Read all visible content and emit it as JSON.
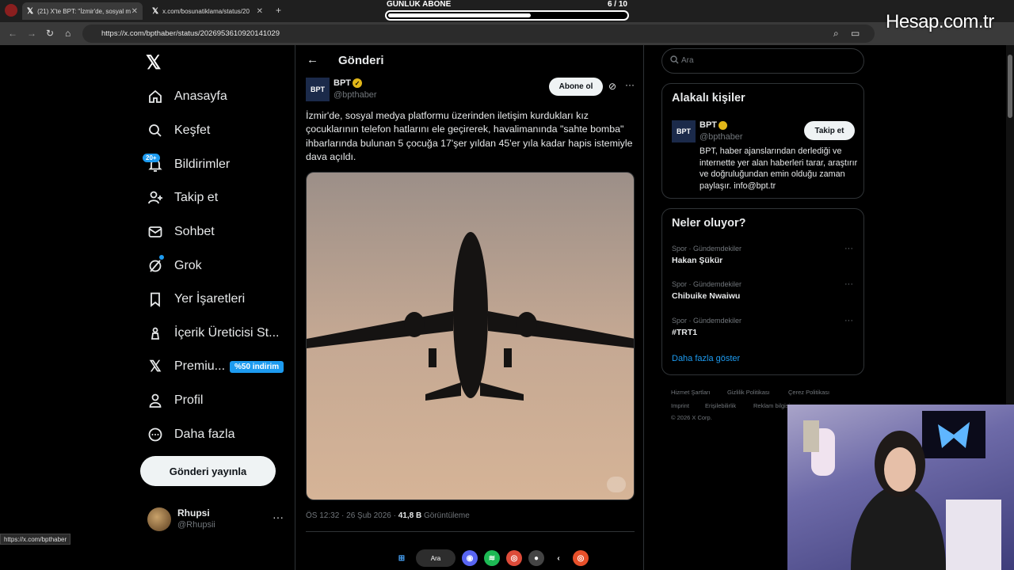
{
  "browser": {
    "tabs": [
      {
        "label": "(21) X'te BPT: \"İzmir'de, sosyal m",
        "active": true
      },
      {
        "label": "x.com/bosunatiklama/status/20",
        "active": false
      }
    ],
    "new_tab": "+",
    "url": "https://x.com/bpthaber/status/2026953610920141029",
    "status_url": "https://x.com/bpthaber"
  },
  "overlay": {
    "progress_title": "GÜNLÜK ABONE",
    "progress_count": "6  / 10",
    "progress_fraction": 0.6,
    "logo_text": "Hesap.com.tr"
  },
  "sidebar": {
    "items": [
      {
        "label": "Anasayfa",
        "icon": "home-icon"
      },
      {
        "label": "Keşfet",
        "icon": "search-icon"
      },
      {
        "label": "Bildirimler",
        "icon": "bell-icon"
      },
      {
        "label": "Takip et",
        "icon": "follow-icon"
      },
      {
        "label": "Sohbet",
        "icon": "mail-icon"
      },
      {
        "label": "Grok",
        "icon": "grok-icon"
      },
      {
        "label": "Yer İşaretleri",
        "icon": "bookmark-icon"
      },
      {
        "label": "İçerik Üreticisi St...",
        "icon": "creator-icon"
      },
      {
        "label": "Premiu...",
        "icon": "x-premium-icon"
      },
      {
        "label": "Profil",
        "icon": "profile-icon"
      },
      {
        "label": "Daha fazla",
        "icon": "more-circle-icon"
      }
    ],
    "notif_badge": "20+",
    "premium_badge": "%50 indirim",
    "post_button": "Gönderi yayınla",
    "profile": {
      "name": "Rhupsi",
      "handle": "@Rhupsii",
      "more": "···"
    }
  },
  "main": {
    "header_title": "Gönderi",
    "author": {
      "name": "BPT",
      "handle": "@bpthaber",
      "avatar_text": "BPT"
    },
    "subscribe": "Abone ol",
    "more": "···",
    "text": "İzmir'de, sosyal medya platformu üzerinden iletişim kurdukları kız çocuklarının telefon hatlarını ele geçirerek, havalimanında \"sahte bomba\" ihbarlarında bulunan 5 çocuğa 17'şer yıldan 45'er yıla kadar hapis istemiyle dava açıldı.",
    "time": "ÖS 12:32 · 26 Şub 2026 · ",
    "views_count": "41,8 B",
    "views_label": " Görüntüleme"
  },
  "right": {
    "search_placeholder": "Ara",
    "related_title": "Alakalı kişiler",
    "related": {
      "name": "BPT",
      "handle": "@bpthaber",
      "avatar_text": "BPT",
      "follow": "Takip et",
      "bio": "BPT, haber ajanslarından derlediği ve internette yer alan haberleri tarar, araştırır ve doğruluğundan emin olduğu zaman paylaşır. info@bpt.tr"
    },
    "trends_title": "Neler oluyor?",
    "trends": [
      {
        "category": "Spor · Gündemdekiler",
        "name": "Hakan Şükür"
      },
      {
        "category": "Spor · Gündemdekiler",
        "name": "Chibuike Nwaiwu"
      },
      {
        "category": "Spor · Gündemdekiler",
        "name": "#TRT1"
      }
    ],
    "show_more": "Daha fazla göster",
    "footer": [
      "Hizmet Şartları",
      "Gizlilik Politikası",
      "Çerez Politikası",
      "Imprint",
      "Erişilebilirlik",
      "Reklam bilgisi",
      "© 2026 X Corp."
    ]
  },
  "taskbar": {
    "search_label": "Ara"
  },
  "colors": {
    "accent": "#1d9bf0",
    "verified": "#e2b719",
    "background": "#000000",
    "text": "#e7e9ea",
    "muted": "#71767b"
  }
}
